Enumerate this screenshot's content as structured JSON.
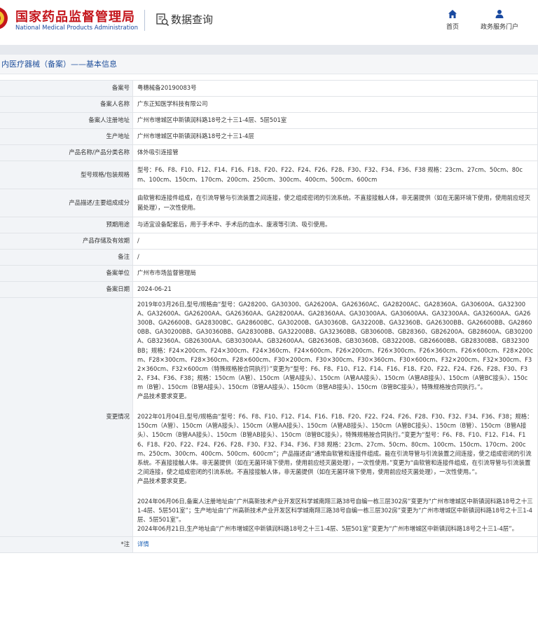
{
  "header": {
    "brand_cn": "国家药品监督管理局",
    "brand_en": "National Medical Products Administration",
    "section_name": "数据查询",
    "nav": [
      {
        "label": "首页",
        "icon": "home-icon"
      },
      {
        "label": "政务服务门户",
        "icon": "user-icon"
      }
    ],
    "colors": {
      "brand_red": "#c4161c",
      "brand_blue": "#1a4aa0"
    }
  },
  "section_title": "内医疗器械（备案）——基本信息",
  "fields": {
    "record_no": {
      "label": "备案号",
      "value": "粤穗械备20190083号"
    },
    "registrant_name": {
      "label": "备案人名称",
      "value": "广东正知医学科技有限公司"
    },
    "registrant_address": {
      "label": "备案人注册地址",
      "value": "广州市增城区中新镇润科路18号之十三1-4层、5层501室"
    },
    "production_address": {
      "label": "生产地址",
      "value": "广州市增城区中新镇润科路18号之十三1-4层"
    },
    "product_name": {
      "label": "产品名称/产品分类名称",
      "value": "体外吸引连接管"
    },
    "model_spec": {
      "label": "型号规格/包装规格",
      "value": "型号：F6、F8、F10、F12、F14、F16、F18、F20、F22、F24、F26、F28、F30、F32、F34、F36、F38 规格：23cm、27cm、50cm、80cm、100cm、150cm、170cm、200cm、250cm、300cm、400cm、500cm、600cm"
    },
    "description": {
      "label": "产品描述/主要组成成分",
      "value": "由软管和连接件组成，在引流导管与引流装置之间连接，使之组成密闭的引流系统。不直接接触人体，非无菌提供（如在无菌环境下使用，使用前应经灭菌处理），一次性使用。"
    },
    "intended_use": {
      "label": "预期用途",
      "value": "与适宜设备配套后，用于手术中、手术后的血水、废液等引流、吸引使用。"
    },
    "storage": {
      "label": "产品存储及有效期",
      "value": "/"
    },
    "remark": {
      "label": "备注",
      "value": "/"
    },
    "record_unit": {
      "label": "备案单位",
      "value": "广州市市场监督管理局"
    },
    "record_date": {
      "label": "备案日期",
      "value": "2024-06-21"
    },
    "changes": {
      "label": "变更情况",
      "items": [
        "2019年03月26日,型号/规格由“型号：GA28200、GA30300、GA26200A、GA26360AC、GA28200AC、GA28360A、GA30600A、GA32300A、GA32600A、GA26200AA、GA26360AA、GA28200AA、GA28360AA、GA30300AA、GA30600AA、GA32300AA、GA32600AA、GA26300B、GA26600B、GA28300BC、GA28600BC、GA30200B、GA30360B、GA32200B、GA32360B、GA26300BB、GA26600BB、GA28600BB、GA30200BB、GA30360BB、GA28300BB、GA32200BB、GA32360BB、GB30600B、GB28360、GB26200A、GB28600A、GB30200A、GB32360A、GB26300AA、GB30300AA、GB32600AA、GB26360B、GB30360B、GB32200B、GB26600BB、GB28300BB、GB32300BB；规格：F24×200cm、F24×300cm、F24×360cm、F24×600cm、F26×200cm、F26×300cm、F26×360cm、F26×600cm、F28×200cm、F28×300cm、F28×360cm、F28×600cm、F30×200cm、F30×300cm、F30×360cm、F30×600cm、F32×200cm、F32×300cm、F32×360cm、F32×600cm（特殊规格按合同执行）”变更为“型号：F6、F8、F10、F12、F14、F16、F18、F20、F22、F24、F26、F28、F30、F32、F34、F36、F38；规格：150cm（A管）、150cm（A管A接头）、150cm（A管AA接头）、150cm（A管AB接头）、150cm（A管BC接头）、150cm（B管）、150cm（B管A接头）、150cm（B管AA接头）、150cm（B管AB接头）、150cm（B管BC接头），特殊规格按合同执行。”。\n产品技术要求变更。",
        "2022年01月04日,型号/规格由“型号：F6、F8、F10、F12、F14、F16、F18、F20、F22、F24、F26、F28、F30、F32、F34、F36、F38；规格：150cm（A管）、150cm（A管A接头）、150cm（A管AA接头）、150cm（A管AB接头）、150cm（A管BC接头）、150cm（B管）、150cm（B管A接头）、150cm（B管AA接头）、150cm（B管AB接头）、150cm（B管BC接头），特殊规格按合同执行。”变更为“型号：F6、F8、F10、F12、F14、F16、F18、F20、F22、F24、F26、F28、F30、F32、F34、F36、F38 规格：23cm、27cm、50cm、80cm、100cm、150cm、170cm、200cm、250cm、300cm、400cm、500cm、600cm”；产品描述由“通常由软管和连接件组成。能在引流导管与引流装置之间连接，使之组成密闭的引流系统。不直接接触人体。非无菌提供（如在无菌环境下使用，使用前应经灭菌处理），一次性使用。”变更为“由软管和连接件组成，在引流导管与引流装置之间连接，使之组成密闭的引流系统。不直接接触人体，非无菌提供（如在无菌环境下使用，使用前应经灭菌处理），一次性使用。”。\n产品技术要求变更。",
        "2024年06月06日,备案人注册地址由“广州高新技术产业开发区科学城南翔三路38号自编一栋三层302房”变更为“广州市增城区中新镇润科路18号之十三1-4层、5层501室”；生产地址由“广州高新技术产业开发区科学城南翔三路38号自编一栋三层302房”变更为“广州市增城区中新镇润科路18号之十三1-4层、5层501室”。\n2024年06月21日,生产地址由“广州市增城区中新镇润科路18号之十三1-4层、5层501室”变更为“广州市增城区中新镇润科路18号之十三1-4层”。"
      ]
    },
    "note": {
      "label": "*注",
      "link_text": "详情"
    }
  }
}
